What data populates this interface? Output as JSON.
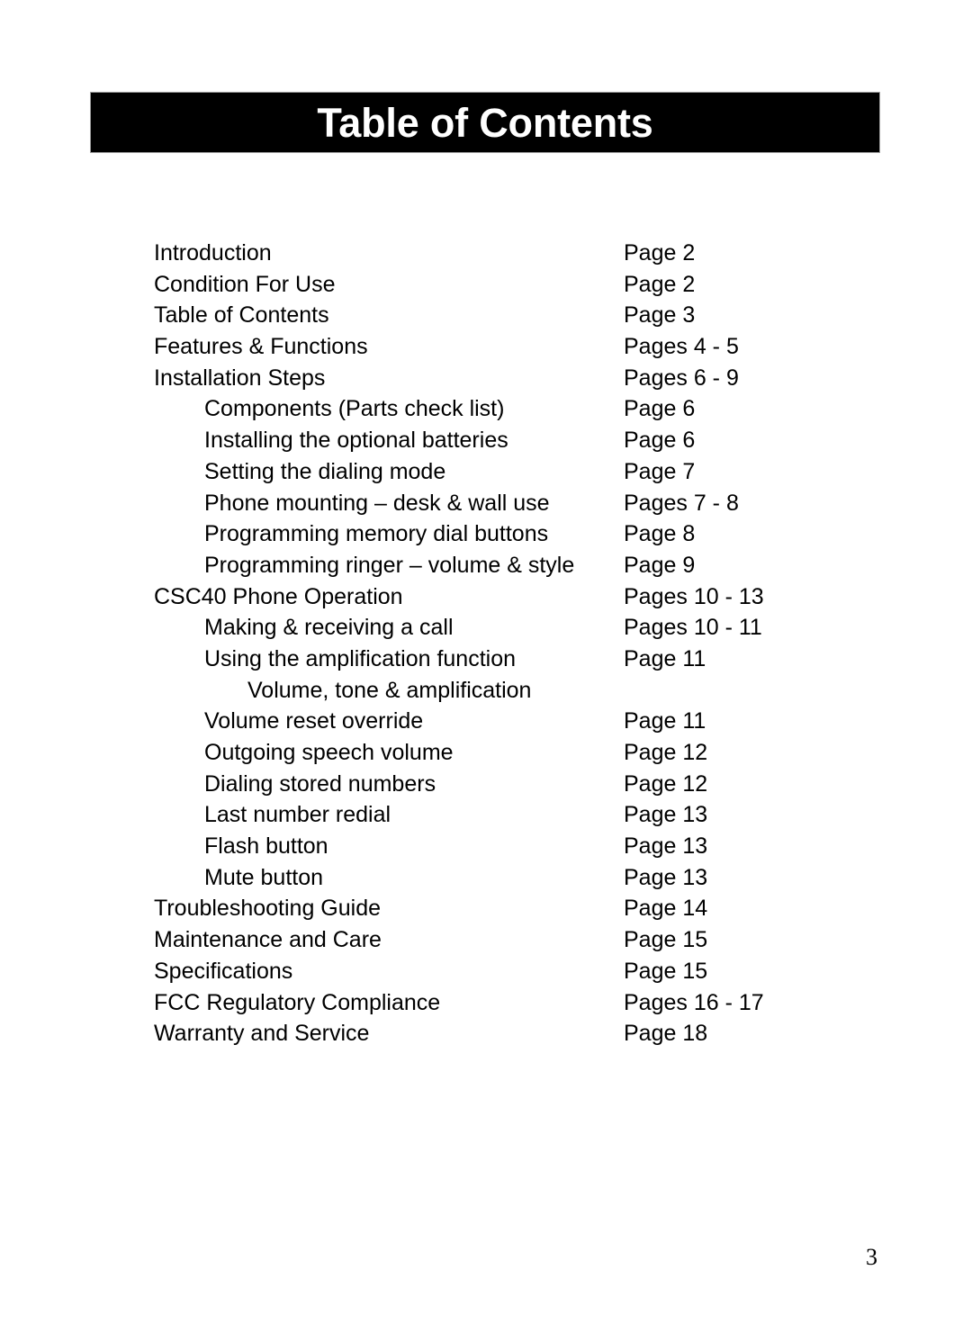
{
  "document": {
    "title": "Table of Contents",
    "page_number": "3"
  },
  "toc": {
    "entries": [
      {
        "label": "Introduction",
        "page": "Page 2",
        "level": 0
      },
      {
        "label": "Condition For Use",
        "page": "Page 2",
        "level": 0
      },
      {
        "label": "Table of Contents",
        "page": "Page 3",
        "level": 0
      },
      {
        "label": "Features & Functions",
        "page": "Pages 4 - 5",
        "level": 0
      },
      {
        "label": "Installation Steps",
        "page": "Pages 6 - 9",
        "level": 0
      },
      {
        "label": "Components (Parts check list)",
        "page": "Page 6",
        "level": 1
      },
      {
        "label": "Installing the optional batteries",
        "page": "Page 6",
        "level": 1
      },
      {
        "label": "Setting the dialing mode",
        "page": "Page 7",
        "level": 1
      },
      {
        "label": "Phone mounting – desk & wall use",
        "page": "Pages 7 - 8",
        "level": 1
      },
      {
        "label": "Programming memory dial buttons",
        "page": "Page 8",
        "level": 1
      },
      {
        "label": "Programming ringer – volume & style",
        "page": "Page 9",
        "level": 1
      },
      {
        "label": "CSC40 Phone Operation",
        "page": "Pages 10 - 13",
        "level": 0
      },
      {
        "label": "Making & receiving a call",
        "page": "Pages 10 - 11",
        "level": 1
      },
      {
        "label": "Using the amplification function",
        "page": "Page 11",
        "level": 1
      },
      {
        "label": "Volume, tone & amplification",
        "page": "",
        "level": 2
      },
      {
        "label": "Volume reset override",
        "page": "Page 11",
        "level": 1
      },
      {
        "label": "Outgoing speech volume",
        "page": "Page 12",
        "level": 1
      },
      {
        "label": "Dialing stored numbers",
        "page": "Page 12",
        "level": 1
      },
      {
        "label": "Last number redial",
        "page": "Page 13",
        "level": 1
      },
      {
        "label": "Flash button",
        "page": "Page 13",
        "level": 1
      },
      {
        "label": "Mute button",
        "page": "Page 13",
        "level": 1
      },
      {
        "label": "Troubleshooting Guide",
        "page": "Page 14",
        "level": 0
      },
      {
        "label": "Maintenance and Care",
        "page": "Page 15",
        "level": 0
      },
      {
        "label": "Specifications",
        "page": "Page 15",
        "level": 0
      },
      {
        "label": "FCC Regulatory Compliance",
        "page": "Pages 16 - 17",
        "level": 0
      },
      {
        "label": "Warranty and Service",
        "page": "Page 18",
        "level": 0
      }
    ]
  }
}
